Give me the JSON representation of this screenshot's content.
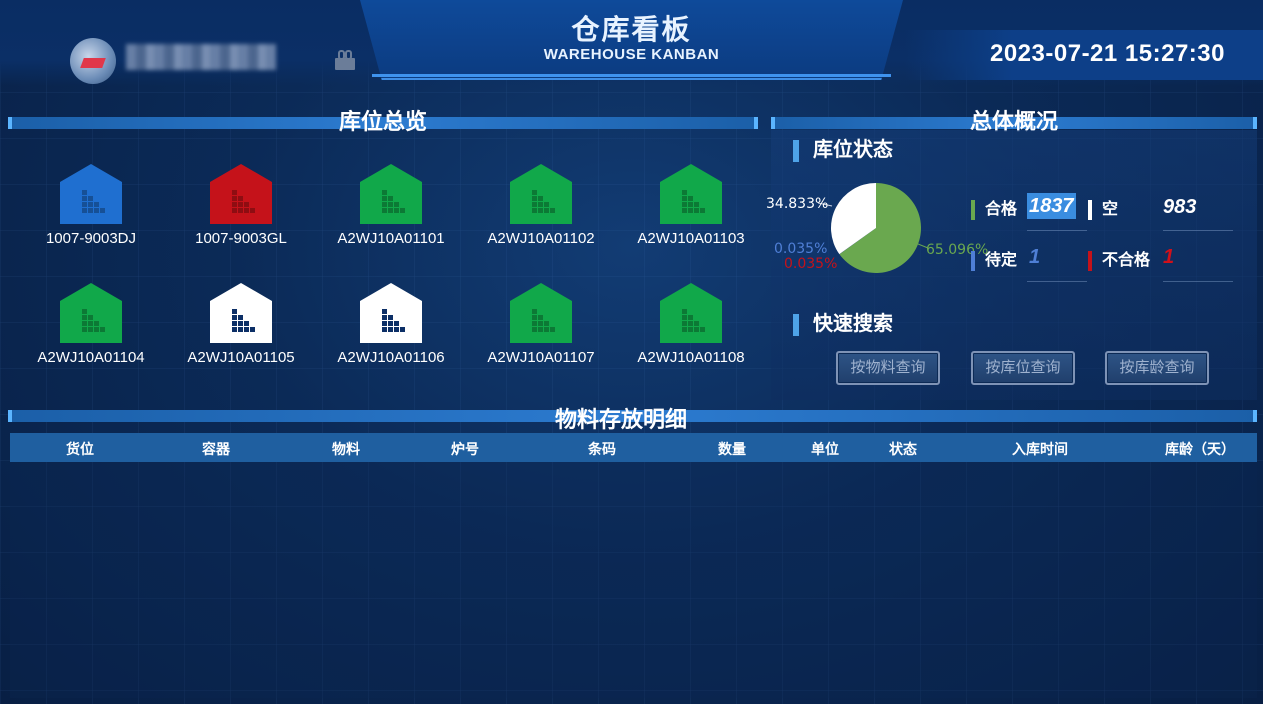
{
  "header": {
    "title": "仓库看板",
    "subtitle": "WAREHOUSE KANBAN",
    "datetime": "2023-07-21 15:27:30"
  },
  "colors": {
    "blue": "#1f6fd0",
    "red": "#c5121a",
    "green": "#11a84a",
    "white": "#ffffff",
    "pie_green": "#6aa84f",
    "accent": "#4ea3e8"
  },
  "overview": {
    "title": "库位总览",
    "warehouses": [
      {
        "label": "1007-9003DJ",
        "status": "blue"
      },
      {
        "label": "1007-9003GL",
        "status": "red"
      },
      {
        "label": "A2WJ10A01101",
        "status": "green"
      },
      {
        "label": "A2WJ10A01102",
        "status": "green"
      },
      {
        "label": "A2WJ10A01103",
        "status": "green"
      },
      {
        "label": "A2WJ10A01104",
        "status": "green"
      },
      {
        "label": "A2WJ10A01105",
        "status": "white"
      },
      {
        "label": "A2WJ10A01106",
        "status": "white"
      },
      {
        "label": "A2WJ10A01107",
        "status": "green"
      },
      {
        "label": "A2WJ10A01108",
        "status": "green"
      }
    ]
  },
  "summary": {
    "title": "总体概况",
    "status_title": "库位状态",
    "pie": {
      "white_label": "34.833%",
      "green_label": "65.096%",
      "blue_label": "0.035%",
      "red_label": "0.035%"
    },
    "stats": {
      "qualified_label": "合格",
      "qualified_value": "1837",
      "empty_label": "空",
      "empty_value": "983",
      "pending_label": "待定",
      "pending_value": "1",
      "unqualified_label": "不合格",
      "unqualified_value": "1"
    },
    "search_title": "快速搜索",
    "buttons": {
      "by_material": "按物料查询",
      "by_location": "按库位查询",
      "by_age": "按库龄查询"
    }
  },
  "detail": {
    "title": "物料存放明细",
    "columns": [
      "货位",
      "容器",
      "物料",
      "炉号",
      "条码",
      "数量",
      "单位",
      "状态",
      "入库时间",
      "库龄（天）"
    ]
  }
}
